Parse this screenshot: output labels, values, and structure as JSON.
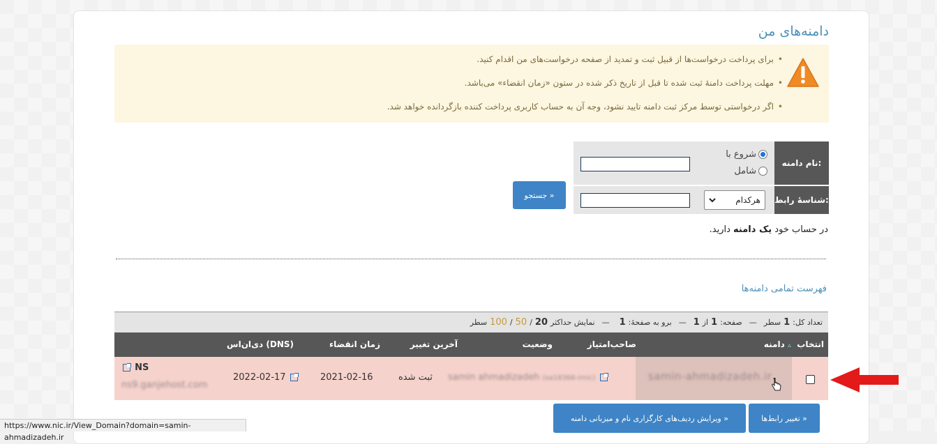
{
  "page": {
    "title": "دامنه‌های من"
  },
  "warning": {
    "items": [
      "برای پرداخت درخواست‌ها از قبیل ثبت و تمدید از صفحه درخواست‌های من اقدام کنید.",
      "مهلت پرداخت دامنهٔ ثبت شده تا قبل از تاریخ ذکر شده در ستون «زمان انقضاء» می‌باشد.",
      "اگر درخواستی توسط مرکز ثبت دامنه تایید نشود، وجه آن به حساب کاربری پرداخت کننده بازگردانده خواهد شد."
    ]
  },
  "search": {
    "domain_label": "نام دامنه:",
    "contact_label": "شناسهٔ رابط:",
    "radio_starts_with": "شروع با",
    "radio_contains": "شامل",
    "domain_input_value": "",
    "contact_input_value": "",
    "select_value": "هرکدام",
    "search_button": "جستجو »"
  },
  "summary": {
    "prefix": "در حساب خود",
    "bold": "یک دامنه",
    "suffix": "دارید."
  },
  "list": {
    "title": "فهرست تمامی دامنه‌ها",
    "pager": {
      "total_label": "تعداد کل:",
      "total_value": "1",
      "total_unit": "سطر",
      "page_label": "صفحه:",
      "page_value": "1",
      "page_of": "از",
      "page_total": "1",
      "goto_label": "برو به صفحهٔ:",
      "goto_value": "1",
      "show_label": "نمایش حداکثر",
      "size_20": "20",
      "size_50": "50",
      "size_100": "100",
      "size_unit": "سطر",
      "separator": "—",
      "slash": "/"
    },
    "columns": {
      "select": "انتخاب",
      "domain": "دامنه",
      "owner": "صاحب‌امتیاز",
      "status": "وضعیت",
      "last_change": "آخرین تغییر",
      "expiry": "زمان انقضاء",
      "dns": "دی‌ان‌اس (DNS)"
    },
    "sort_indicator": "▵",
    "rows": [
      {
        "domain": "samin-ahmadizadeh.ir",
        "owner": "samin ahmadizadeh",
        "owner_id": "(sa18366-irnic)",
        "status": "ثبت شده",
        "last_change": "2021-02-16",
        "expiry": "2022-02-17",
        "dns_title": "NS",
        "dns_value": "ns9.ganjehost.com"
      }
    ]
  },
  "actions": {
    "edit_ns_button": "ویرایش ردیف‌های کارگزاری نام و میزبانی دامنه »",
    "change_contacts_button": "تغییر رابط‌ها »"
  },
  "statusbar": {
    "url": "https://www.nic.ir/View_Domain?domain=samin-ahmadizadeh.ir"
  },
  "colors": {
    "accent": "#4a90b8",
    "button": "#3e84c6",
    "header_dark": "#575757",
    "row_highlight": "#f6d2cc",
    "warning_bg": "#fdf6e0",
    "arrow": "#e31a1a"
  }
}
